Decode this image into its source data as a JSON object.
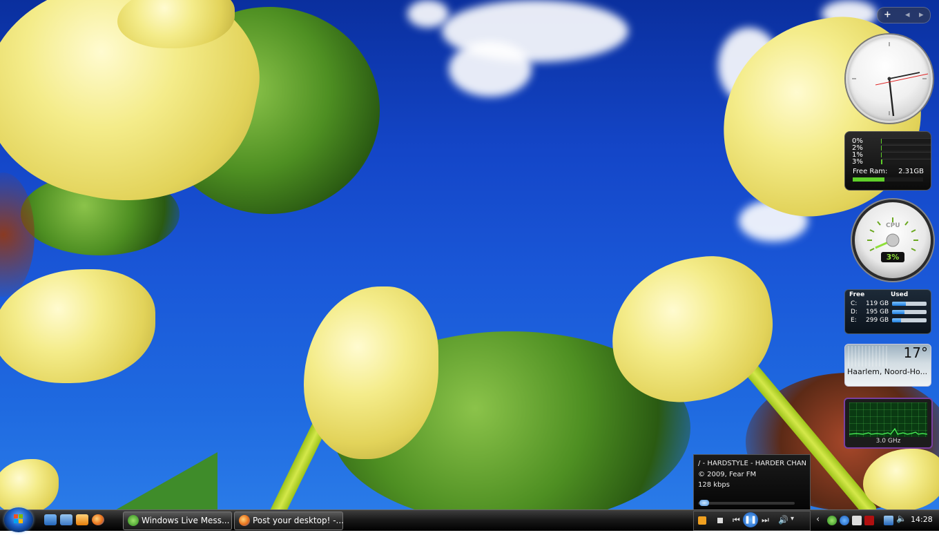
{
  "sidebar": {
    "add_glyph": "+",
    "prev_glyph": "◂",
    "next_glyph": "▸"
  },
  "meter": {
    "cores": [
      {
        "label": "0%",
        "value": 0.0
      },
      {
        "label": "2%",
        "value": 0.02
      },
      {
        "label": "1%",
        "value": 0.01
      },
      {
        "label": "3%",
        "value": 0.03
      }
    ],
    "ram_label": "Free Ram:",
    "ram_value": "2.31GB",
    "ram_fill": 0.45,
    "bar_color": "#5fcf2a"
  },
  "cpu_gauge": {
    "title": "CPU",
    "value": "3%"
  },
  "drives": {
    "header_free": "Free",
    "header_used": "Used",
    "items": [
      {
        "letter": "C:",
        "free": "119 GB",
        "used": 0.4
      },
      {
        "letter": "D:",
        "free": "195 GB",
        "used": 0.35
      },
      {
        "letter": "E:",
        "free": "299 GB",
        "used": 0.25
      }
    ]
  },
  "weather": {
    "temp": "17°",
    "location": "Haarlem, Noord-Ho..."
  },
  "freq": {
    "label": "3.0 GHz"
  },
  "media": {
    "title": "/ - HARDSTYLE - HARDER CHAN",
    "copyright": "© 2009, Fear FM",
    "bitrate": "128 kbps"
  },
  "taskbar": {
    "tasks": [
      {
        "label": "Windows Live Mess..."
      },
      {
        "label": "Post your desktop! -..."
      }
    ],
    "time": "14:28"
  },
  "colors": {
    "sky": "#1446c8",
    "accent_purple": "#7a3fa0",
    "graph_green": "#4cff5a"
  }
}
